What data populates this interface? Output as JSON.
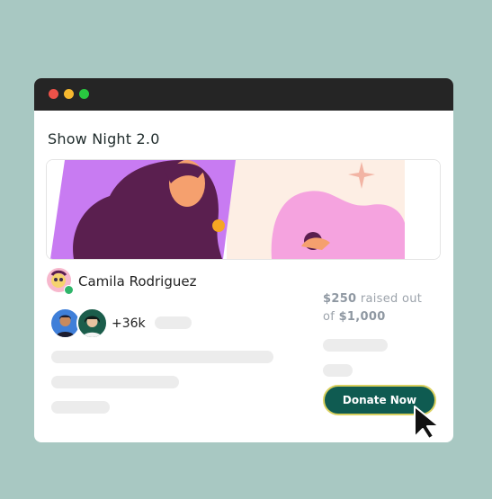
{
  "window": {
    "controls": [
      "close",
      "minimize",
      "maximize"
    ]
  },
  "campaign": {
    "title": "Show Night 2.0",
    "author": "Camila Rodriguez",
    "supporters_count": "+36k",
    "raised_amount": "$250",
    "raised_text": "raised out",
    "goal_prefix": "of",
    "goal_amount": "$1,000",
    "donate_label": "Donate Now"
  },
  "colors": {
    "background": "#a8c8c2",
    "titlebar": "#252525",
    "button": "#0f5b51",
    "button_border": "#d9d05e",
    "banner_purple": "#c87bf2",
    "banner_dark": "#5a1f4f",
    "banner_pink": "#f5a3df"
  },
  "icons": {
    "cursor": "pointer-arrow-icon",
    "verified": "verified-badge-icon"
  }
}
